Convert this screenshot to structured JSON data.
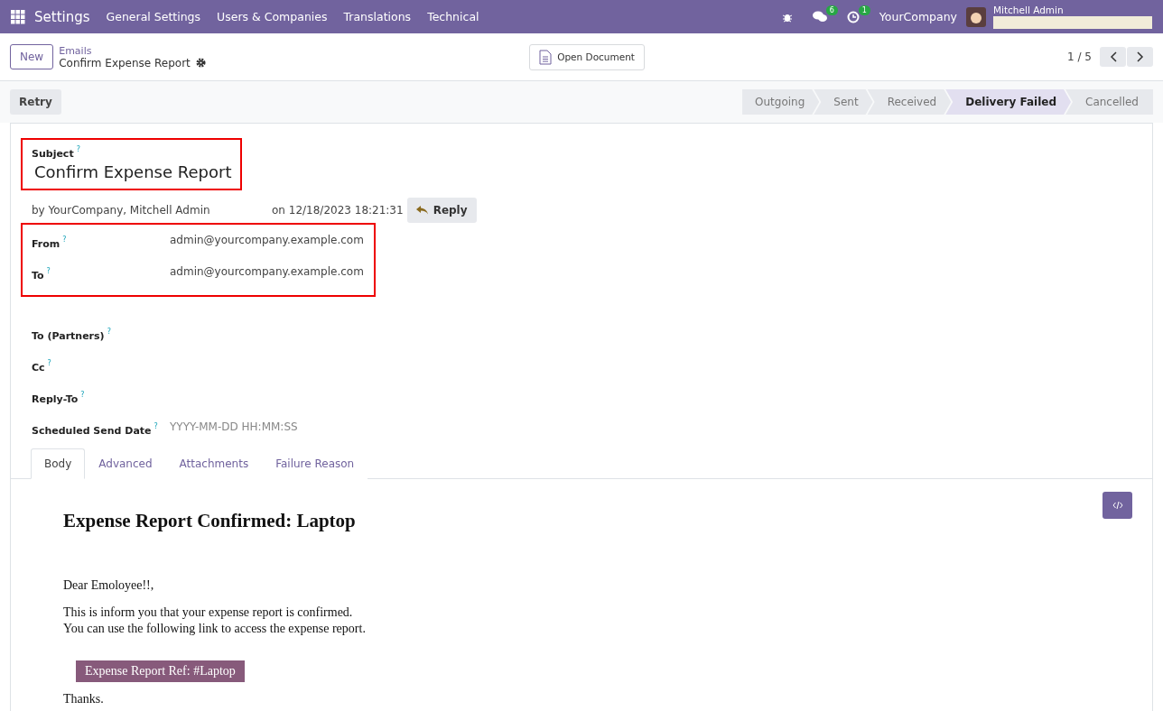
{
  "navbar": {
    "app": "Settings",
    "menus": [
      "General Settings",
      "Users & Companies",
      "Translations",
      "Technical"
    ],
    "messages_count": "6",
    "activities_count": "1",
    "company": "YourCompany",
    "user": "Mitchell Admin"
  },
  "control_panel": {
    "new_button": "New",
    "breadcrumb": "Emails",
    "record_title": "Confirm Expense Report",
    "open_document": "Open Document",
    "pager": "1 / 5"
  },
  "status_bar": {
    "retry": "Retry",
    "stages": [
      {
        "label": "Outgoing",
        "selected": false
      },
      {
        "label": "Sent",
        "selected": false
      },
      {
        "label": "Received",
        "selected": false
      },
      {
        "label": "Delivery Failed",
        "selected": true
      },
      {
        "label": "Cancelled",
        "selected": false
      }
    ]
  },
  "subject": {
    "label": "Subject",
    "help": "?",
    "value": "Confirm Expense Report",
    "highlighted": true
  },
  "meta": {
    "by": "by  YourCompany, Mitchell Admin",
    "date": "on 12/18/2023 18:21:31",
    "reply": "Reply"
  },
  "fields": [
    {
      "label": "From",
      "help": "?",
      "value": "admin@yourcompany.example.com",
      "highlighted": true
    },
    {
      "label": "To",
      "help": "?",
      "value": "admin@yourcompany.example.com",
      "highlighted": true
    },
    {
      "label": "To (Partners)",
      "help": "?",
      "highlighted": false
    },
    {
      "label": "Cc",
      "help": "?",
      "highlighted": false
    },
    {
      "label": "Reply-To",
      "help": "?",
      "highlighted": false
    },
    {
      "label": "Scheduled Send Date",
      "help": "?",
      "placeholder": "YYYY-MM-DD HH:MM:SS",
      "highlighted": false
    }
  ],
  "tabs": [
    {
      "label": "Body",
      "selected": true
    },
    {
      "label": "Advanced",
      "selected": false
    },
    {
      "label": "Attachments",
      "selected": false
    },
    {
      "label": "Failure Reason",
      "selected": false
    }
  ],
  "body": {
    "heading": "Expense Report Confirmed: Laptop",
    "greeting": "Dear Emoloyee!!,",
    "lines": [
      "This is inform you that your expense report is confirmed.",
      "You can use the following link to access the expense report."
    ],
    "link_button": "Expense Report Ref: #Laptop",
    "closing": "Thanks."
  }
}
